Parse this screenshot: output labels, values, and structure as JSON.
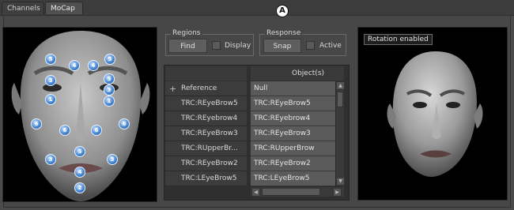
{
  "tabs": [
    {
      "label": "Channels"
    },
    {
      "label": "MoCap"
    }
  ],
  "regions": {
    "title": "Regions",
    "find_label": "Find",
    "display_label": "Display"
  },
  "response": {
    "title": "Response",
    "snap_label": "Snap",
    "active_label": "Active"
  },
  "callout": "A",
  "left_list": [
    {
      "label": "Reference",
      "add_icon": "+"
    },
    {
      "label": "TRC:REyeBrow5"
    },
    {
      "label": "TRC:REyebrow4"
    },
    {
      "label": "TRC:REyeBrow3"
    },
    {
      "label": "TRC:RUpperBr..."
    },
    {
      "label": "TRC:REyeBrow2"
    },
    {
      "label": "TRC:LEyeBrow5"
    }
  ],
  "objects": {
    "header": "Object(s)",
    "items": [
      "Null",
      "TRC:REyeBrow5",
      "TRC:REyebrow4",
      "TRC:REyeBrow3",
      "TRC:RUpperBrow",
      "TRC:REyeBrow2",
      "TRC:LEyeBrow5"
    ]
  },
  "preview": {
    "label": "Rotation enabled"
  },
  "markers": [
    "5",
    "5",
    "4",
    "4",
    "5",
    "3",
    "3",
    "1",
    "1",
    "6",
    "6",
    "6",
    "6",
    "5",
    "3",
    "3",
    "4",
    "2"
  ],
  "colors": {
    "marker": "#3f82cf",
    "background": "#4a4a4a",
    "row_selected": "#5a5a5a"
  }
}
